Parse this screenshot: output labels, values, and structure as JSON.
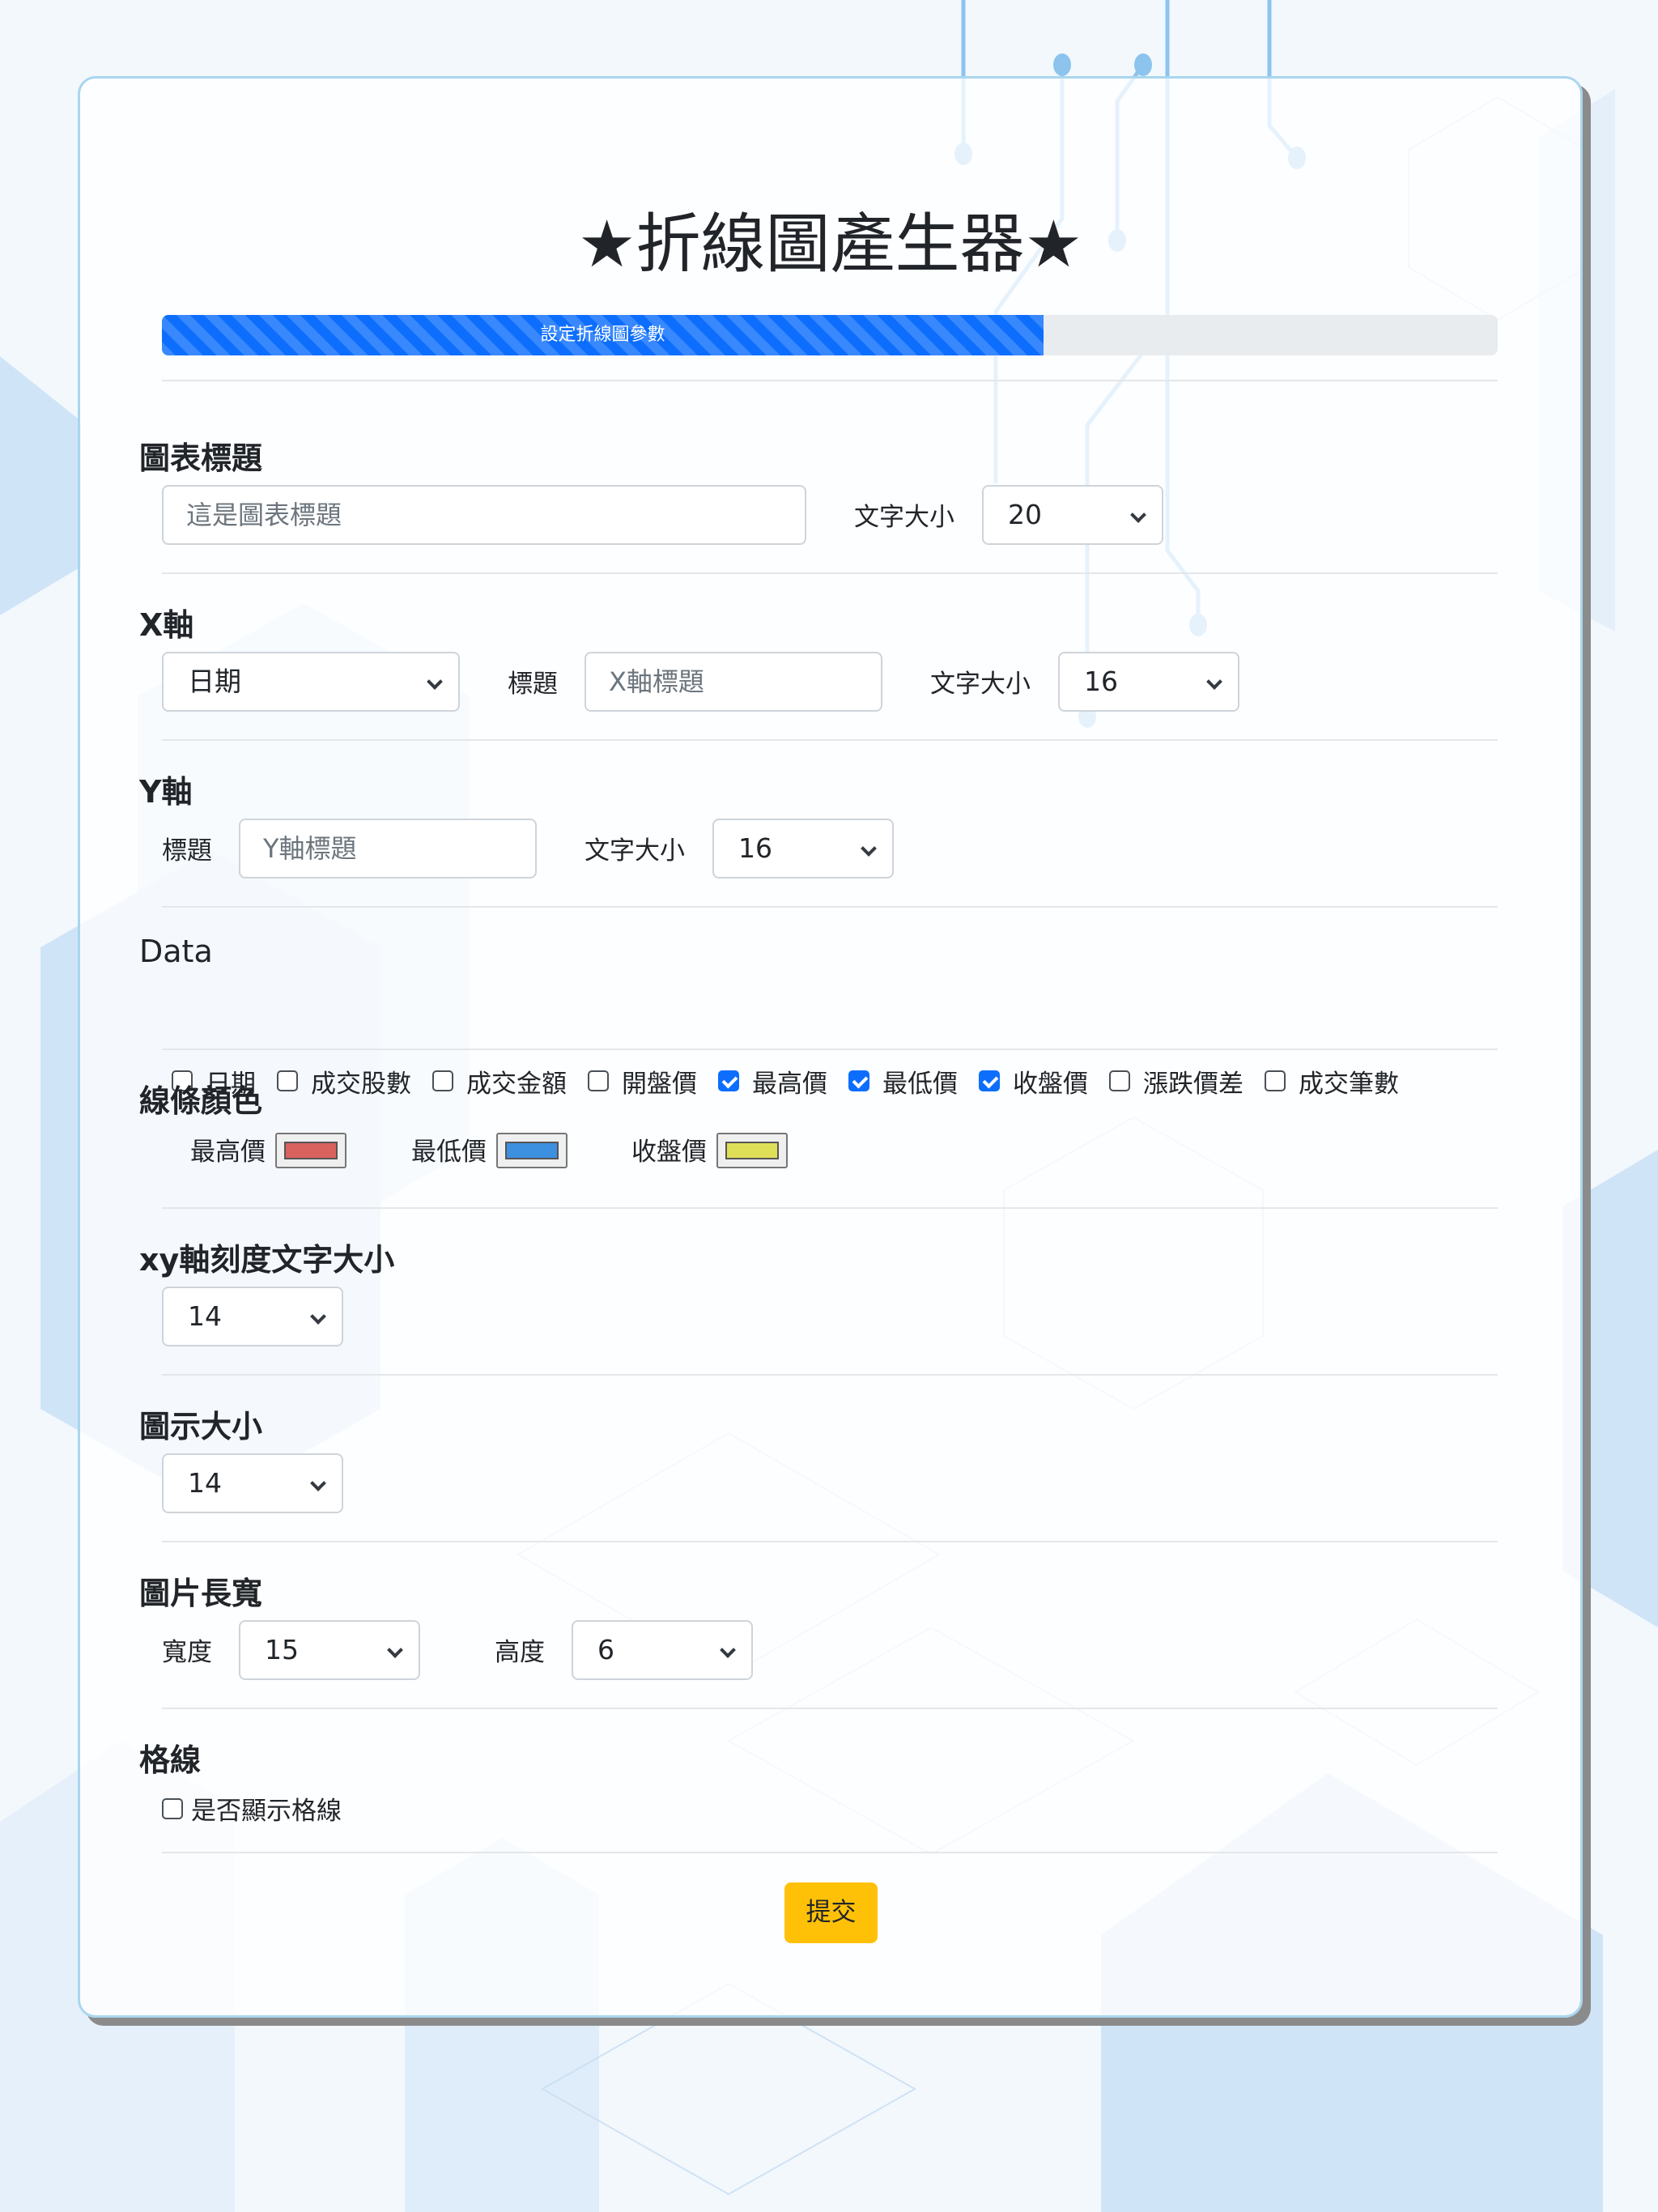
{
  "page_title": "★折線圖產生器★",
  "progress": {
    "label": "設定折線圖參數",
    "percent": 66
  },
  "chart_title": {
    "heading": "圖表標題",
    "placeholder": "這是圖表標題",
    "font_size_label": "文字大小",
    "font_size_value": "20"
  },
  "x_axis": {
    "heading": "X軸",
    "column_value": "日期",
    "title_label": "標題",
    "title_placeholder": "X軸標題",
    "font_size_label": "文字大小",
    "font_size_value": "16"
  },
  "y_axis": {
    "heading": "Y軸",
    "title_label": "標題",
    "title_placeholder": "Y軸標題",
    "font_size_label": "文字大小",
    "font_size_value": "16"
  },
  "data": {
    "heading": "Data",
    "options": [
      {
        "label": "日期",
        "checked": false
      },
      {
        "label": "成交股數",
        "checked": false
      },
      {
        "label": "成交金額",
        "checked": false
      },
      {
        "label": "開盤價",
        "checked": false
      },
      {
        "label": "最高價",
        "checked": true
      },
      {
        "label": "最低價",
        "checked": true
      },
      {
        "label": "收盤價",
        "checked": true
      },
      {
        "label": "漲跌價差",
        "checked": false
      },
      {
        "label": "成交筆數",
        "checked": false
      }
    ]
  },
  "line_colors": {
    "heading": "線條顏色",
    "items": [
      {
        "label": "最高價",
        "color": "#d9625e"
      },
      {
        "label": "最低價",
        "color": "#3d8fdf"
      },
      {
        "label": "收盤價",
        "color": "#dfdf58"
      }
    ]
  },
  "tick_font": {
    "heading": "xy軸刻度文字大小",
    "value": "14"
  },
  "legend_size": {
    "heading": "圖示大小",
    "value": "14"
  },
  "image_size": {
    "heading": "圖片長寬",
    "width_label": "寬度",
    "width_value": "15",
    "height_label": "高度",
    "height_value": "6"
  },
  "grid": {
    "heading": "格線",
    "label": "是否顯示格線",
    "checked": false
  },
  "submit_label": "提交",
  "colors": {
    "accent": "#0d6efd",
    "submit": "#ffc107",
    "card_border": "#a9d6ee",
    "circuit": "#8cc4ee"
  }
}
